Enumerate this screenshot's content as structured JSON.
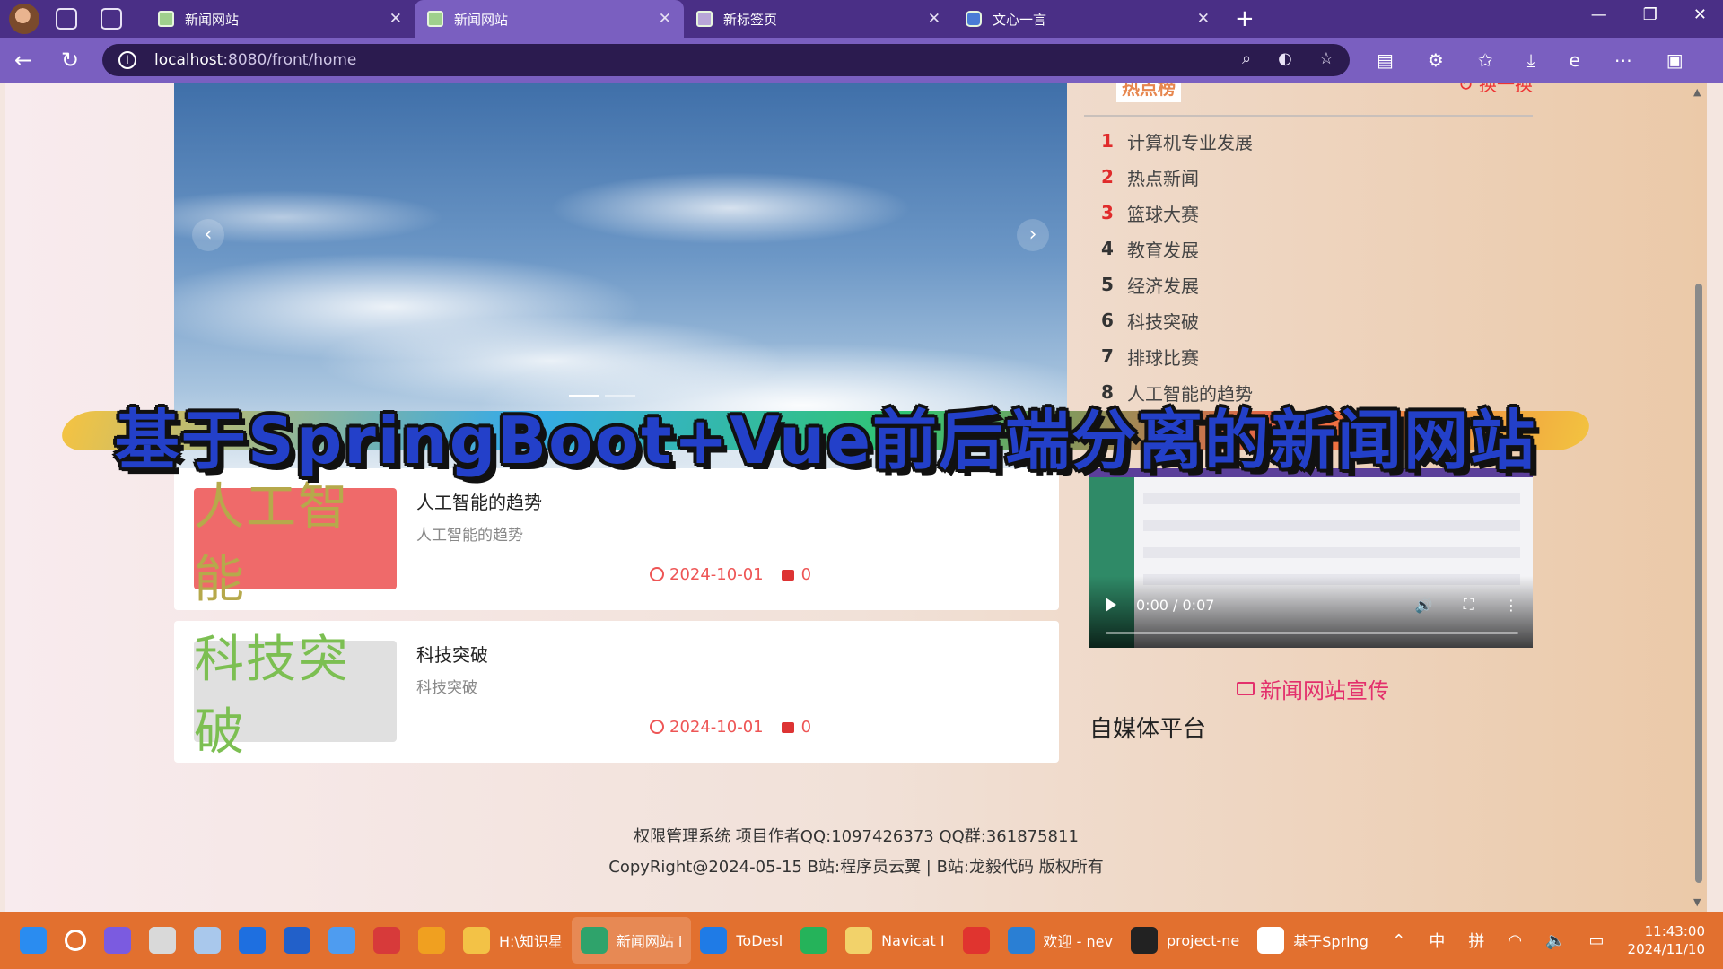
{
  "browser": {
    "tabs": [
      {
        "title": "新闻网站",
        "active": false
      },
      {
        "title": "新闻网站",
        "active": true
      },
      {
        "title": "新标签页",
        "active": false
      },
      {
        "title": "文心一言",
        "active": false
      }
    ],
    "url_host": "localhost",
    "url_path": ":8080/front/home"
  },
  "carousel": {
    "prev": "‹",
    "next": "›"
  },
  "news": [
    {
      "thumb_text": "人工智能",
      "title": "人工智能的趋势",
      "desc": "人工智能的趋势",
      "date": "2024-10-01",
      "comments": "0",
      "thumb_style": "red"
    },
    {
      "thumb_text": "科技突破",
      "title": "科技突破",
      "desc": "科技突破",
      "date": "2024-10-01",
      "comments": "0",
      "thumb_style": "gray"
    }
  ],
  "hot": {
    "badge": "热点榜",
    "refresh": "↻ 换一换",
    "items": [
      {
        "num": "1",
        "label": "计算机专业发展"
      },
      {
        "num": "2",
        "label": "热点新闻"
      },
      {
        "num": "3",
        "label": "篮球大赛"
      },
      {
        "num": "4",
        "label": "教育发展"
      },
      {
        "num": "5",
        "label": "经济发展"
      },
      {
        "num": "6",
        "label": "科技突破"
      },
      {
        "num": "7",
        "label": "排球比赛"
      },
      {
        "num": "8",
        "label": "人工智能的趋势"
      }
    ]
  },
  "video": {
    "time": "0:00 / 0:07"
  },
  "promo_label": "新闻网站宣传",
  "media_title": "自媒体平台",
  "footer": {
    "line1": "权限管理系统 项目作者QQ:1097426373 QQ群:361875811",
    "line2": "CopyRight@2024-05-15 B站:程序员云翼 | B站:龙毅代码 版权所有"
  },
  "overlay_banner": "基于SpringBoot+Vue前后端分离的新闻网站",
  "taskbar": {
    "apps": [
      {
        "icon": "windows-start-icon",
        "label": "",
        "color": "#2a8cf0"
      },
      {
        "icon": "search-icon",
        "label": "",
        "color": "transparent"
      },
      {
        "icon": "copilot-icon",
        "label": "",
        "color": "#7b5be0"
      },
      {
        "icon": "task-view-icon",
        "label": "",
        "color": "#d9d9d9"
      },
      {
        "icon": "cloud-icon",
        "label": "",
        "color": "#a9c8ec"
      },
      {
        "icon": "pin-icon",
        "label": "",
        "color": "#1e6fe0"
      },
      {
        "icon": "store-icon",
        "label": "",
        "color": "#2260c9"
      },
      {
        "icon": "bird-icon",
        "label": "",
        "color": "#4e9cf0"
      },
      {
        "icon": "star-app-icon",
        "label": "",
        "color": "#d73a3a"
      },
      {
        "icon": "triangle-app-icon",
        "label": "",
        "color": "#f0a020"
      },
      {
        "icon": "folder-icon",
        "label": "H:\\知识星",
        "color": "#f3c246"
      },
      {
        "icon": "edge-icon",
        "label": "新闻网站 i",
        "color": "#2fa36b",
        "active": true
      },
      {
        "icon": "todesk-icon",
        "label": "ToDesl",
        "color": "#1f7be6"
      },
      {
        "icon": "player-icon",
        "label": "",
        "color": "#25b35a"
      },
      {
        "icon": "navicat-icon",
        "label": "Navicat I",
        "color": "#f2d26a"
      },
      {
        "icon": "wps-icon",
        "label": "",
        "color": "#e0342f"
      },
      {
        "icon": "vscode-icon",
        "label": "欢迎 - nev",
        "color": "#2a7fd4"
      },
      {
        "icon": "intellij-icon",
        "label": "project-ne",
        "color": "#222"
      },
      {
        "icon": "typora-icon",
        "label": "基于Spring",
        "color": "#fff"
      }
    ],
    "tray": {
      "ime1": "中",
      "ime2": "拼",
      "time": "11:43:00",
      "date": "2024/11/10"
    }
  }
}
